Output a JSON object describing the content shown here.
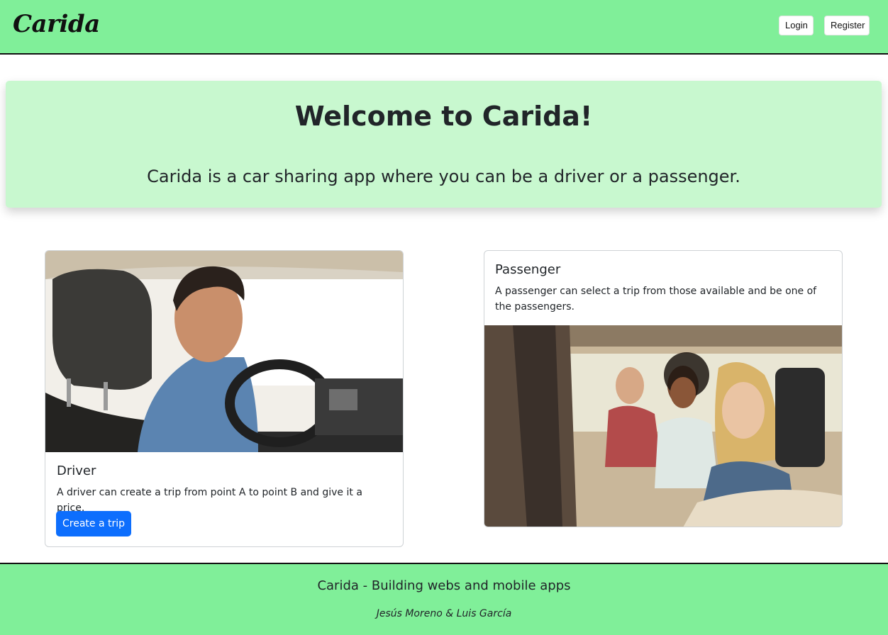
{
  "navbar": {
    "brand": "Carida",
    "login_label": "Login",
    "register_label": "Register"
  },
  "hero": {
    "title": "Welcome to Carida!",
    "subtitle": "Carida is a car sharing app where you can be a driver or a passenger."
  },
  "cards": {
    "driver": {
      "image": "smiling-driver-photo",
      "title": "Driver",
      "text": "A driver can create a trip from point A to point B and give it a price.",
      "button_label": "Create a trip"
    },
    "passenger": {
      "image": "passengers-in-car-photo",
      "title": "Passenger",
      "text": "A passenger can select a trip from those available and be one of the passengers."
    }
  },
  "footer": {
    "text": "Carida - Building webs and mobile apps",
    "authors": "Jesús Moreno & Luis García"
  },
  "colors": {
    "navbar_bg": "#80ef99",
    "hero_bg": "#c8f8cf",
    "primary_button": "#0d6efd"
  }
}
